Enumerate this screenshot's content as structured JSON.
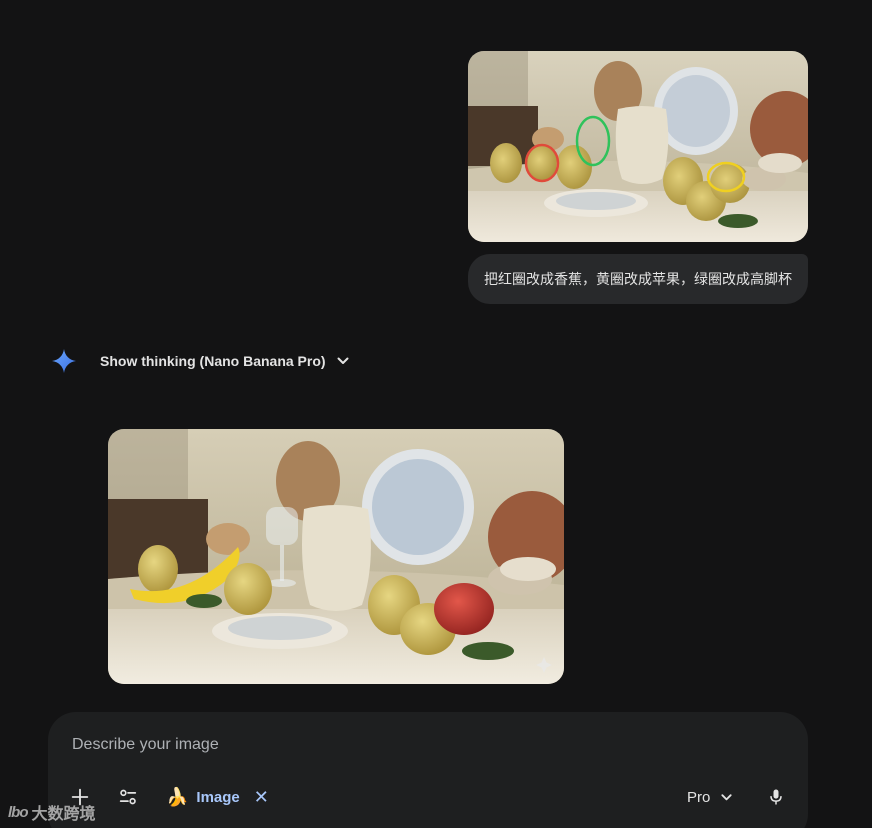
{
  "conversation": {
    "user_message": {
      "image_label": "user-uploaded still life with circled fruits",
      "text": "把红圈改成香蕉，黄圈改成苹果，绿圈改成高脚杯"
    },
    "model_response": {
      "spark_icon": "gemini-spark-icon",
      "thinking_label": "Show thinking (Nano Banana Pro)",
      "image_label": "generated still life image"
    }
  },
  "composer": {
    "placeholder": "Describe your image",
    "value": "",
    "chip": {
      "emoji": "🍌",
      "label": "Image",
      "close": "✕"
    },
    "model_label": "Pro"
  },
  "watermark": {
    "logo": "lbo",
    "text": "大数跨境"
  },
  "colors": {
    "background": "#131314",
    "bubble": "#28292b",
    "composer": "#1e1f20",
    "accent": "#a8c7fa",
    "spark_blue": "#4c8df6"
  }
}
